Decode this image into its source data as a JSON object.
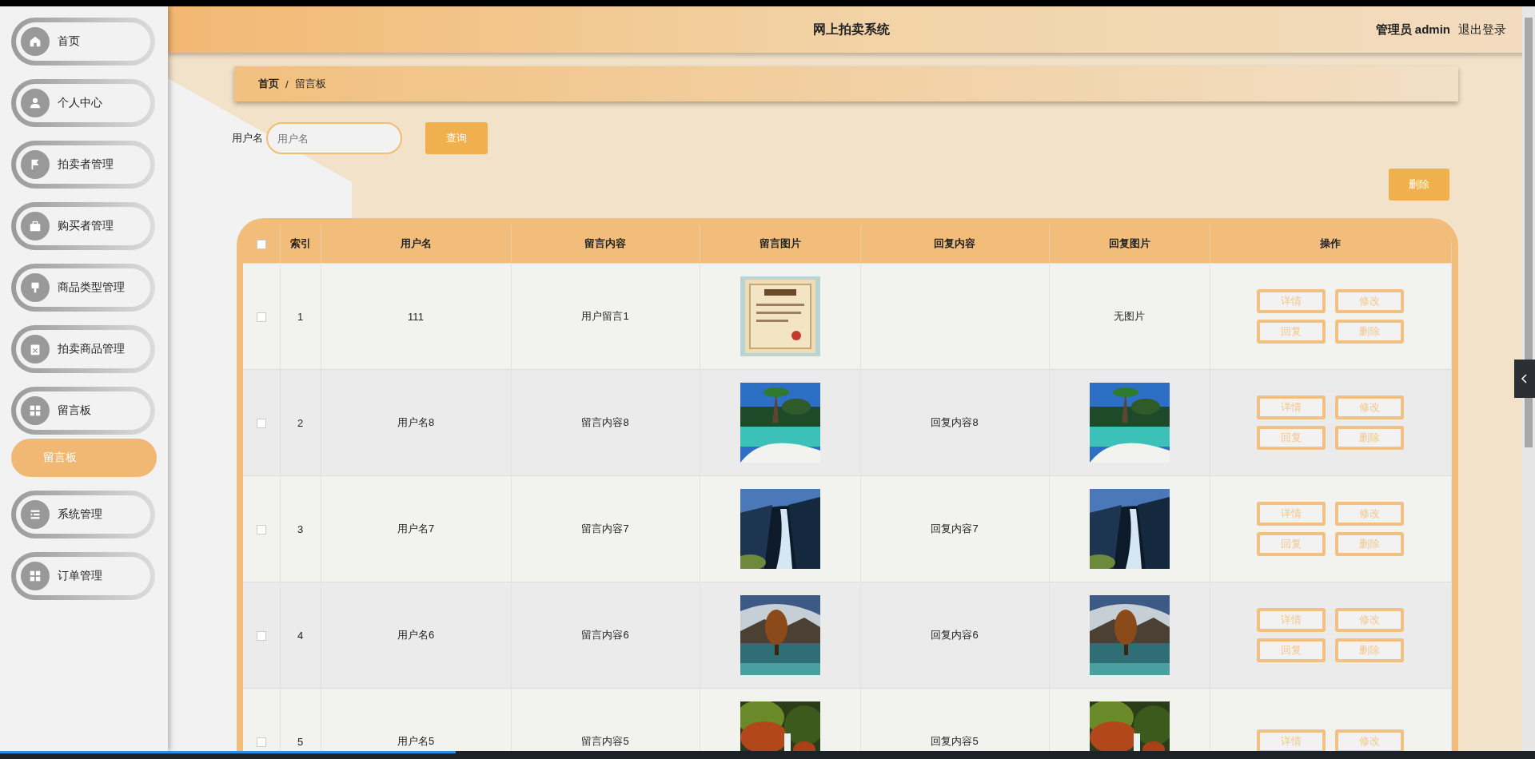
{
  "sidebar": {
    "items": [
      {
        "label": "首页"
      },
      {
        "label": "个人中心"
      },
      {
        "label": "拍卖者管理"
      },
      {
        "label": "购买者管理"
      },
      {
        "label": "商品类型管理"
      },
      {
        "label": "拍卖商品管理"
      },
      {
        "label": "留言板",
        "children": [
          {
            "label": "留言板",
            "selected": true
          }
        ]
      },
      {
        "label": "系统管理"
      },
      {
        "label": "订单管理"
      }
    ]
  },
  "header": {
    "title": "网上拍卖系统",
    "user": "管理员 admin",
    "logout": "退出登录"
  },
  "breadcrumb": {
    "items": [
      "首页",
      "留言板"
    ],
    "separator": "/"
  },
  "search": {
    "label": "用户名",
    "placeholder": "用户名",
    "button": "查询"
  },
  "delete_button": "删除",
  "table": {
    "header_checked": false,
    "columns": [
      "索引",
      "用户名",
      "留言内容",
      "留言图片",
      "回复内容",
      "回复图片",
      "操作"
    ],
    "rows": [
      {
        "checked": false,
        "index": "1",
        "username": "111",
        "content": "用户留言1",
        "image": {
          "kind": "picture"
        },
        "reply": "",
        "reply_image": {
          "kind": "text",
          "text": "无图片"
        },
        "actions": [
          "详情",
          "修改",
          "回复",
          "删除"
        ]
      },
      {
        "checked": false,
        "index": "2",
        "username": "用户名8",
        "content": "留言内容8",
        "image": {
          "kind": "picture"
        },
        "reply": "回复内容8",
        "reply_image": {
          "kind": "picture"
        },
        "actions": [
          "详情",
          "修改",
          "回复",
          "删除"
        ]
      },
      {
        "checked": false,
        "index": "3",
        "username": "用户名7",
        "content": "留言内容7",
        "image": {
          "kind": "picture"
        },
        "reply": "回复内容7",
        "reply_image": {
          "kind": "picture"
        },
        "actions": [
          "详情",
          "修改",
          "回复",
          "删除"
        ]
      },
      {
        "checked": false,
        "index": "4",
        "username": "用户名6",
        "content": "留言内容6",
        "image": {
          "kind": "picture"
        },
        "reply": "回复内容6",
        "reply_image": {
          "kind": "picture"
        },
        "actions": [
          "详情",
          "修改",
          "回复",
          "删除"
        ]
      },
      {
        "checked": false,
        "index": "5",
        "username": "用户名5",
        "content": "留言内容5",
        "image": {
          "kind": "picture"
        },
        "reply": "回复内容5",
        "reply_image": {
          "kind": "picture"
        },
        "actions": [
          "详情",
          "修改"
        ]
      }
    ]
  }
}
